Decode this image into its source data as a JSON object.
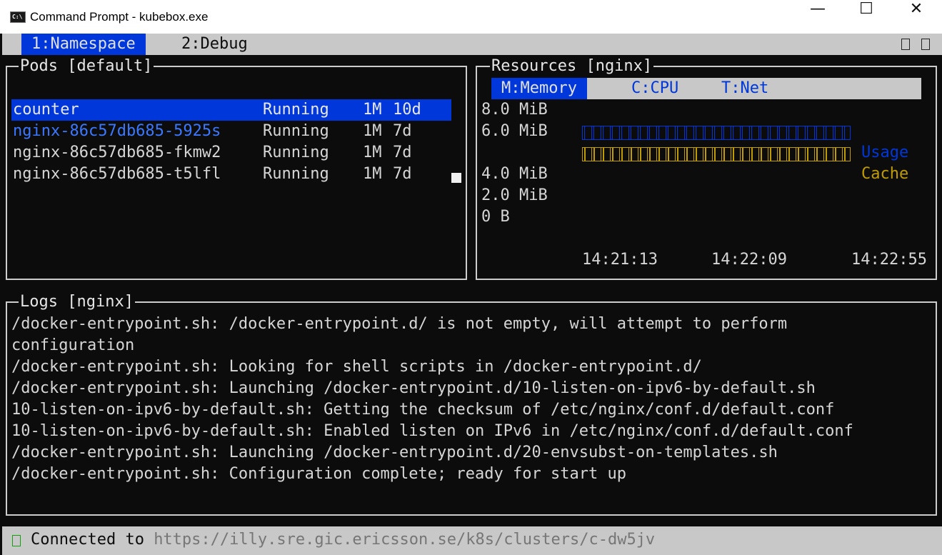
{
  "window": {
    "title": "Command Prompt - kubebox.exe",
    "icon_label": "C:\\",
    "minimize": "—",
    "maximize": "☐",
    "close": "✕"
  },
  "tabs": [
    {
      "label": "1:Namespace"
    },
    {
      "label": "2:Debug"
    }
  ],
  "pods": {
    "title": "Pods [default]",
    "rows": [
      {
        "name": "counter",
        "status": "Running",
        "ready": "1M",
        "age": "10d"
      },
      {
        "name": "nginx-86c57db685-5925s",
        "status": "Running",
        "ready": "1M",
        "age": "7d"
      },
      {
        "name": "nginx-86c57db685-fkmw2",
        "status": "Running",
        "ready": "1M",
        "age": "7d"
      },
      {
        "name": "nginx-86c57db685-t5lfl",
        "status": "Running",
        "ready": "1M",
        "age": "7d"
      }
    ]
  },
  "resources": {
    "title": "Resources [nginx]",
    "tabs": [
      "M:Memory",
      "C:CPU",
      "T:Net"
    ],
    "y_labels": [
      "8.0 MiB",
      "6.0 MiB",
      "4.0 MiB",
      "2.0 MiB",
      "0 B"
    ],
    "legend": {
      "usage": "Usage",
      "cache": "Cache"
    },
    "x_labels": [
      "14:21:13",
      "14:22:09",
      "14:22:55"
    ]
  },
  "colors": {
    "usage": "#0037da",
    "cache": "#c19c00",
    "selection": "#0037da",
    "link": "#3b78ff"
  },
  "chart_data": {
    "type": "bar",
    "title": "Resources [nginx]",
    "ylabel": "",
    "xlabel": "",
    "categories": [
      "14:21:13",
      "14:22:09",
      "14:22:55"
    ],
    "series": [
      {
        "name": "Usage",
        "values": [
          6.0,
          6.0,
          6.0
        ]
      },
      {
        "name": "Cache",
        "values": [
          5.0,
          5.0,
          5.0
        ]
      }
    ],
    "ylim": [
      0,
      8
    ],
    "y_ticks": [
      "0 B",
      "2.0 MiB",
      "4.0 MiB",
      "6.0 MiB",
      "8.0 MiB"
    ]
  },
  "logs": {
    "title": "Logs [nginx]",
    "lines": [
      "/docker-entrypoint.sh: /docker-entrypoint.d/ is not empty, will attempt to perform",
      "configuration",
      "/docker-entrypoint.sh: Looking for shell scripts in /docker-entrypoint.d/",
      "/docker-entrypoint.sh: Launching /docker-entrypoint.d/10-listen-on-ipv6-by-default.sh",
      "10-listen-on-ipv6-by-default.sh: Getting the checksum of /etc/nginx/conf.d/default.conf",
      "10-listen-on-ipv6-by-default.sh: Enabled listen on IPv6 in /etc/nginx/conf.d/default.conf",
      "/docker-entrypoint.sh: Launching /docker-entrypoint.d/20-envsubst-on-templates.sh",
      "/docker-entrypoint.sh: Configuration complete; ready for start up"
    ]
  },
  "status": {
    "prefix": "Connected to ",
    "url": "https://illy.sre.gic.ericsson.se/k8s/clusters/c-dw5jv"
  }
}
